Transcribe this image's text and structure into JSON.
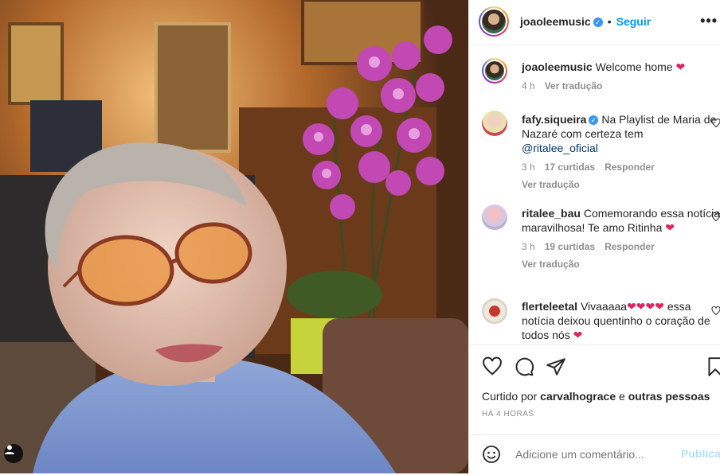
{
  "header": {
    "username": "joaoleemusic",
    "separator": "•",
    "follow_label": "Seguir",
    "more_label": "•••"
  },
  "caption": {
    "username": "joaoleemusic",
    "text": "Welcome home",
    "heart": "❤",
    "time": "4 h",
    "translate": "Ver tradução"
  },
  "comments": [
    {
      "username": "fafy.siqueira",
      "verified": true,
      "text": "Na Playlist de Maria de Nazaré com certeza tem",
      "mention": "@ritalee_oficial",
      "time": "3 h",
      "likes": "17 curtidas",
      "reply": "Responder",
      "translate": "Ver tradução"
    },
    {
      "username": "ritalee_bau",
      "verified": false,
      "text": "Comemorando essa notícia maravilhosa! Te amo Ritinha",
      "heart": "❤",
      "time": "3 h",
      "likes": "19 curtidas",
      "reply": "Responder",
      "translate": "Ver tradução"
    },
    {
      "username": "flerteleetal",
      "verified": false,
      "text_before": "Vivaaaaa",
      "hearts": "❤❤❤❤",
      "text_after": "essa notícia deixou quentinho o coração de todos nós",
      "heart": "❤"
    }
  ],
  "actions": {
    "liked_by_prefix": "Curtido por",
    "liked_by_user": "carvalhograce",
    "liked_by_conj": "e",
    "liked_by_others": "outras pessoas",
    "time": "HÁ 4 HORAS"
  },
  "add_comment": {
    "placeholder": "Adicione um comentário...",
    "publish_label": "Publicar"
  },
  "colors": {
    "accent": "#0095f6",
    "heart": "#e0245e",
    "muted": "#8e8e8e"
  }
}
